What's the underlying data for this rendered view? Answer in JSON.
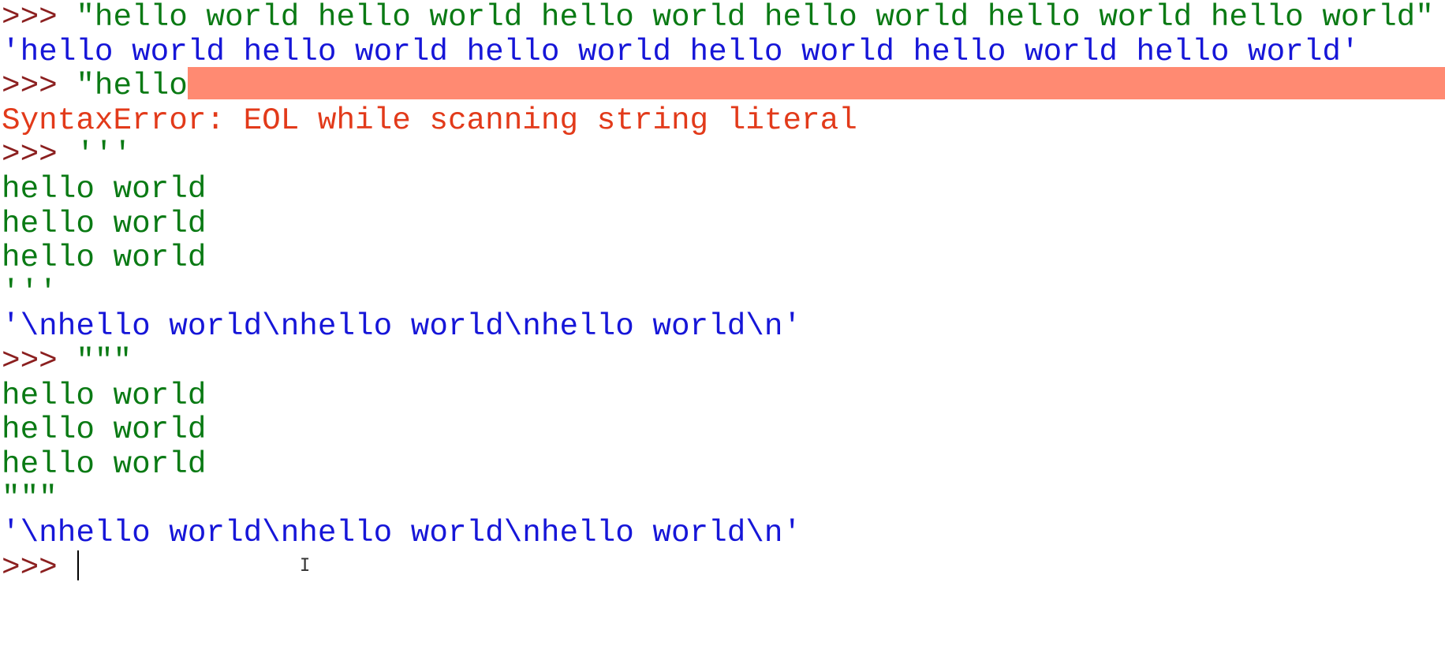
{
  "shell": {
    "prompt": ">>> ",
    "lines": [
      {
        "kind": "input",
        "text": "\"hello world hello world hello world hello world hello world hello world\""
      },
      {
        "kind": "output",
        "text": "'hello world hello world hello world hello world hello world hello world'"
      },
      {
        "kind": "input",
        "text": "\"hello"
      },
      {
        "kind": "error",
        "text": "SyntaxError: EOL while scanning string literal"
      },
      {
        "kind": "input",
        "text": "'''"
      },
      {
        "kind": "cont",
        "text": "hello world"
      },
      {
        "kind": "cont",
        "text": "hello world"
      },
      {
        "kind": "cont",
        "text": "hello world"
      },
      {
        "kind": "cont",
        "text": "'''"
      },
      {
        "kind": "output",
        "text": "'\\nhello world\\nhello world\\nhello world\\n'"
      },
      {
        "kind": "input",
        "text": "\"\"\""
      },
      {
        "kind": "cont",
        "text": "hello world"
      },
      {
        "kind": "cont",
        "text": "hello world"
      },
      {
        "kind": "cont",
        "text": "hello world"
      },
      {
        "kind": "cont",
        "text": "\"\"\""
      },
      {
        "kind": "output",
        "text": "'\\nhello world\\nhello world\\nhello world\\n'"
      },
      {
        "kind": "input",
        "text": ""
      }
    ]
  },
  "colors": {
    "prompt": "#8b1f1f",
    "input": "#0a7a14",
    "output": "#1616d8",
    "error": "#e23a1a",
    "error_highlight": "#ff8a72"
  },
  "icons": {
    "text_cursor": "i-beam-icon"
  }
}
